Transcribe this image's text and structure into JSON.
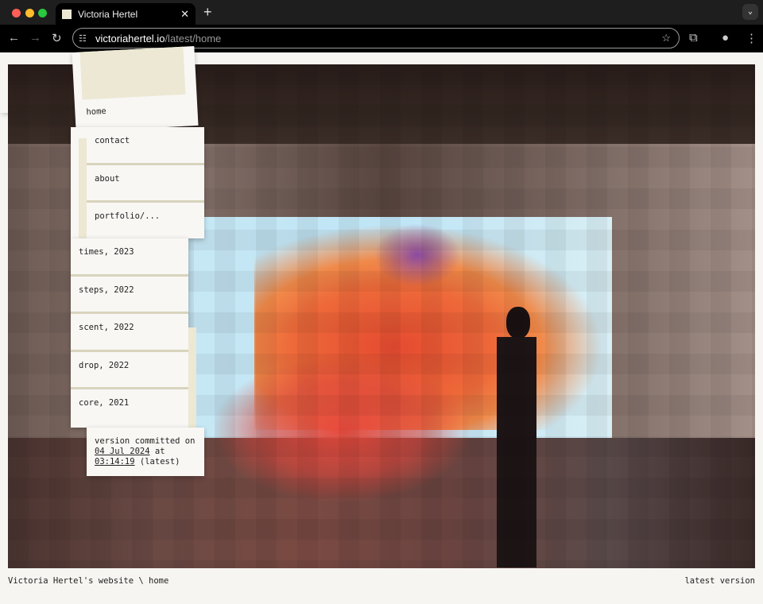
{
  "browser": {
    "tab_title": "Victoria Hertel",
    "url_host": "victoriahertel.io",
    "url_path": "/latest/home",
    "colors": {
      "close": "#ff5f57",
      "minimize": "#febc2e",
      "maximize": "#28c840"
    }
  },
  "nav": {
    "home": "home",
    "items": [
      "contact",
      "about",
      "portfolio/..."
    ],
    "portfolio": [
      "times, 2023",
      "steps, 2022",
      "scent, 2022",
      "drop, 2022",
      "core, 2021"
    ]
  },
  "version": {
    "prefix": "version committed on",
    "date": "04 Jul 2024",
    "at": "at",
    "time": "03:14:19",
    "suffix": "(latest)"
  },
  "footer": {
    "left": "Victoria Hertel's website \\ home",
    "right": "latest version"
  }
}
